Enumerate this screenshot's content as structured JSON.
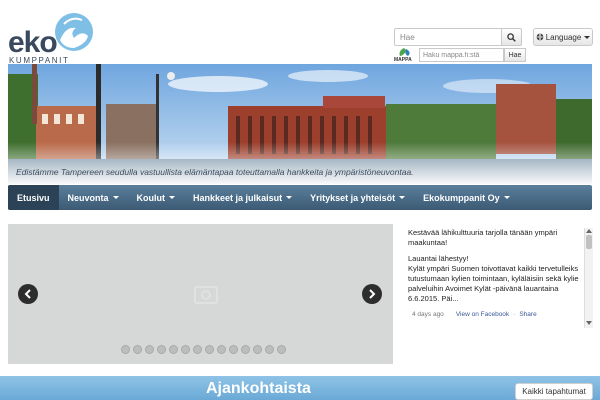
{
  "header": {
    "logo_text": "eko",
    "logo_subtext": "KUMPPANIT",
    "search_placeholder": "Hae",
    "search_icon": "search-icon",
    "language_label": "Language",
    "mappa_logo_text": "MAPPA",
    "mappa_placeholder": "Haku mappa.fi:stä",
    "mappa_button": "Hae"
  },
  "banner": {
    "tagline": "Edistämme Tampereen seudulla vastuullista elämäntapaa toteuttamalla hankkeita ja ympäristöneuvontaa."
  },
  "nav": {
    "items": [
      {
        "label": "Etusivu",
        "dropdown": false,
        "active": true
      },
      {
        "label": "Neuvonta",
        "dropdown": true,
        "active": false
      },
      {
        "label": "Koulut",
        "dropdown": true,
        "active": false
      },
      {
        "label": "Hankkeet ja julkaisut",
        "dropdown": true,
        "active": false
      },
      {
        "label": "Yritykset ja yhteisöt",
        "dropdown": true,
        "active": false
      },
      {
        "label": "Ekokumppanit Oy",
        "dropdown": true,
        "active": false
      }
    ]
  },
  "slider": {
    "dot_count": 14
  },
  "feed": {
    "post1": "Kestävää lähikulttuuria tarjolla tänään ympäri maakuntaa!",
    "post2_line1": "Lauantai lähestyy!",
    "post2_body": "Kylät ympäri Suomen toivottavat kaikki tervetulleiks tutustumaan kylien toimintaan, kyläläisiin sekä kylie palveluihin Avoimet Kylät -päivänä lauantaina 6.6.2015. Päi...",
    "time": "4 days ago",
    "view_link": "View on Facebook",
    "separator": "·",
    "share_link": "Share"
  },
  "bottom": {
    "title": "Ajankohtaista",
    "all_events": "Kaikki tapahtumat"
  }
}
